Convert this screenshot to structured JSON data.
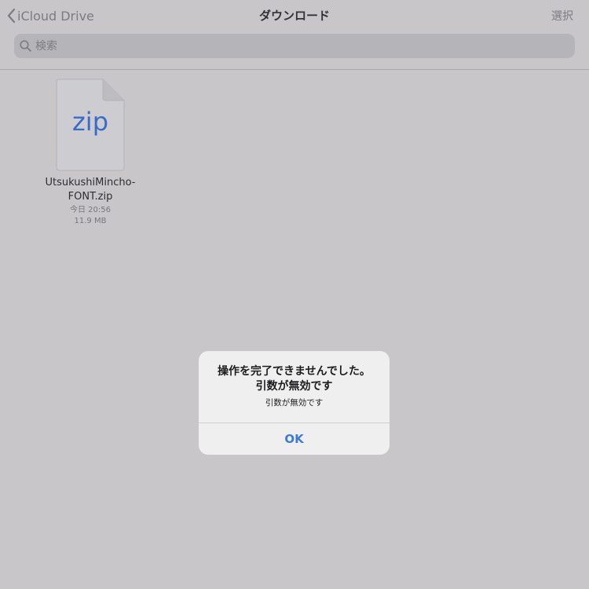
{
  "navbar": {
    "back_label": "iCloud Drive",
    "title": "ダウンロード",
    "select_label": "選択"
  },
  "search": {
    "placeholder": "検索",
    "value": ""
  },
  "files": [
    {
      "icon_text": "zip",
      "name_line1": "UtsukushiMincho-",
      "name_line2": "FONT.zip",
      "date": "今日 20:56",
      "size": "11.9 MB"
    }
  ],
  "alert": {
    "title_line1": "操作を完了できませんでした。",
    "title_line2": "引数が無効です",
    "message": "引数が無効です",
    "ok_label": "OK"
  },
  "colors": {
    "background": "#c8c6c9",
    "accent": "#3d7ad1",
    "zip_icon_text": "#3a6bc7",
    "alert_background": "#f0eff0"
  },
  "icons": {
    "back": "chevron-left-icon",
    "search": "magnifier-icon",
    "file": "zip-document-icon"
  }
}
